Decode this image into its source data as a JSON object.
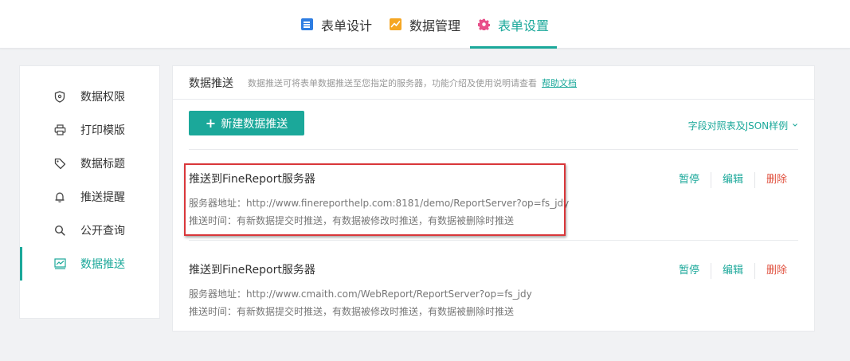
{
  "tabs": [
    {
      "label": "表单设计",
      "icon": "form-design-icon",
      "active": false
    },
    {
      "label": "数据管理",
      "icon": "chart-icon",
      "active": false
    },
    {
      "label": "表单设置",
      "icon": "gear-icon",
      "active": true
    }
  ],
  "sidebar": {
    "items": [
      {
        "label": "数据权限",
        "icon": "shield-icon"
      },
      {
        "label": "打印模版",
        "icon": "printer-icon"
      },
      {
        "label": "数据标题",
        "icon": "tag-icon"
      },
      {
        "label": "推送提醒",
        "icon": "bell-icon"
      },
      {
        "label": "公开查询",
        "icon": "search-icon"
      },
      {
        "label": "数据推送",
        "icon": "trend-icon",
        "active": true
      }
    ]
  },
  "panel": {
    "title": "数据推送",
    "description": "数据推送可将表单数据推送至您指定的服务器，功能介绍及使用说明请查看",
    "help_link": "帮助文档",
    "new_button": "新建数据推送",
    "sample_link": "字段对照表及JSON样例",
    "actions": {
      "pause": "暂停",
      "edit": "编辑",
      "delete": "删除"
    },
    "items": [
      {
        "title": "推送到FineReport服务器",
        "server": "服务器地址：http://www.finereporthelp.com:8181/demo/ReportServer?op=fs_jdy",
        "time": "推送时间：有新数据提交时推送，有数据被修改时推送，有数据被删除时推送",
        "highlighted": true
      },
      {
        "title": "推送到FineReport服务器",
        "server": "服务器地址：http://www.cmaith.com/WebReport/ReportServer?op=fs_jdy",
        "time": "推送时间：有新数据提交时推送，有数据被修改时推送，有数据被删除时推送",
        "highlighted": false
      }
    ]
  },
  "colors": {
    "accent": "#1ba89a",
    "danger": "#e0513f",
    "highlight_border": "#d9373a"
  }
}
